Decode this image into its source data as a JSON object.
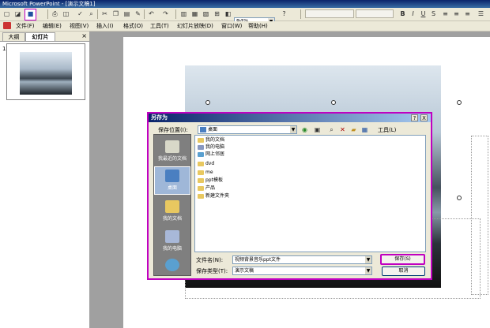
{
  "window": {
    "title": "Microsoft PowerPoint - [演示文稿1]"
  },
  "toolbar": {
    "zoom": "94%"
  },
  "menu": [
    "文件(F)",
    "编辑(E)",
    "视图(V)",
    "插入(I)",
    "格式(O)",
    "工具(T)",
    "幻灯片放映(D)",
    "窗口(W)",
    "帮助(H)"
  ],
  "left_pane": {
    "tab_outline": "大纲",
    "tab_slides": "幻灯片",
    "close": "×",
    "slide_number": "1"
  },
  "dialog": {
    "title": "另存为",
    "help_btn": "?",
    "close_btn": "X",
    "save_in_label": "保存位置(I):",
    "save_in_value": "桌面",
    "tools_label": "工具(L)",
    "places": [
      {
        "label": "我最近的文档",
        "icon": "recent-docs-icon",
        "color": "#d8d8c8"
      },
      {
        "label": "桌面",
        "icon": "desktop-icon",
        "color": "#4a7fc1"
      },
      {
        "label": "我的文档",
        "icon": "my-documents-icon",
        "color": "#e8c860"
      },
      {
        "label": "我的电脑",
        "icon": "my-computer-icon",
        "color": "#a8b8d8"
      },
      {
        "label": "",
        "icon": "network-icon",
        "color": "#5aa0d0"
      }
    ],
    "files": [
      {
        "name": "我的文档",
        "icon": "folder-docs-icon",
        "color": "#e8c860"
      },
      {
        "name": "我的电脑",
        "icon": "computer-icon",
        "color": "#8898c0"
      },
      {
        "name": "网上邻居",
        "icon": "network-icon",
        "color": "#5aa0d0"
      },
      {
        "name": "dvd",
        "icon": "folder-icon",
        "color": "#e8c860"
      },
      {
        "name": "me",
        "icon": "folder-icon",
        "color": "#e8c860"
      },
      {
        "name": "ppt模板",
        "icon": "folder-icon",
        "color": "#e8c860"
      },
      {
        "name": "产品",
        "icon": "folder-icon",
        "color": "#e8c860"
      },
      {
        "name": "新建文件夹",
        "icon": "folder-icon",
        "color": "#e8c860"
      }
    ],
    "filename_label": "文件名(N):",
    "filename_value": "视频背景音乐ppt文件",
    "filetype_label": "保存类型(T):",
    "filetype_value": "演示文稿",
    "save_button": "保存(S)",
    "cancel_button": "取消"
  },
  "colors": {
    "highlight": "#c000c0",
    "titlebar": "#0a246a"
  }
}
